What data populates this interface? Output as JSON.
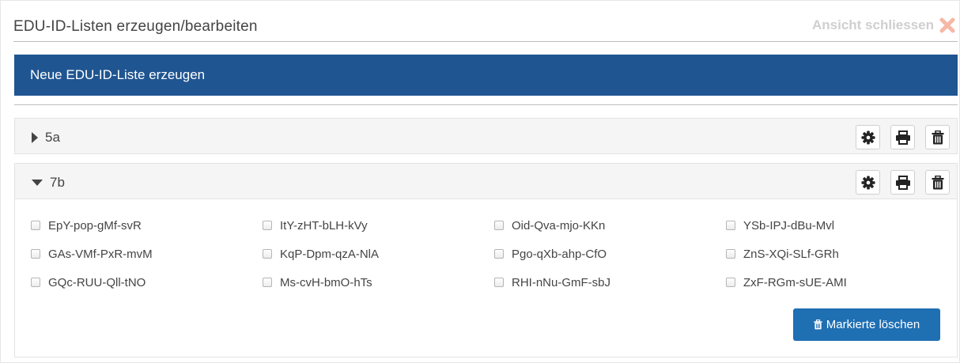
{
  "header": {
    "title": "EDU-ID-Listen erzeugen/bearbeiten",
    "close_label": "Ansicht schliessen"
  },
  "new_list_label": "Neue EDU-ID-Liste erzeugen",
  "groups": [
    {
      "name": "5a",
      "expanded": false
    },
    {
      "name": "7b",
      "expanded": true
    }
  ],
  "items": [
    "EpY-pop-gMf-svR",
    "ItY-zHT-bLH-kVy",
    "Oid-Qva-mjo-KKn",
    "YSb-IPJ-dBu-Mvl",
    "GAs-VMf-PxR-mvM",
    "KqP-Dpm-qzA-NlA",
    "Pgo-qXb-ahp-CfO",
    "ZnS-XQi-SLf-GRh",
    "GQc-RUU-Qll-tNO",
    "Ms-cvH-bmO-hTs",
    "RHI-nNu-GmF-sbJ",
    "ZxF-RGm-sUE-AMI"
  ],
  "delete_marked_label": "Markierte löschen",
  "colors": {
    "primary_bar": "#1f5591",
    "button": "#1f6fb3",
    "close_icon": "#f6b8a6"
  },
  "icons": [
    "gear-icon",
    "print-icon",
    "trash-icon",
    "caret-right-icon",
    "caret-down-icon",
    "close-icon"
  ]
}
